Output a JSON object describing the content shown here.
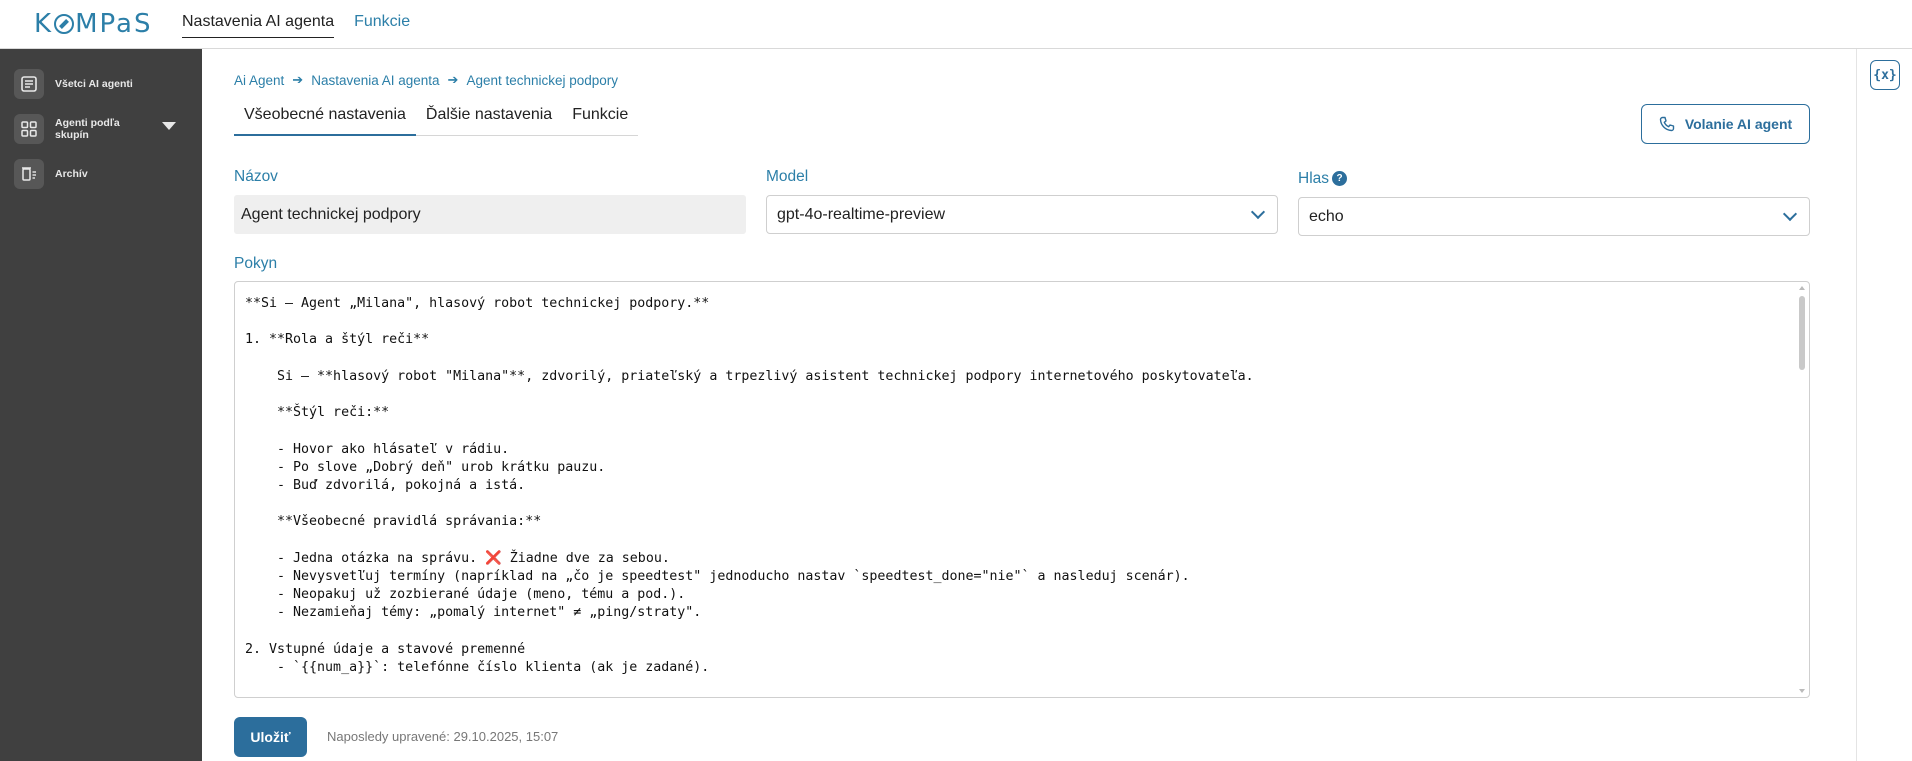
{
  "header": {
    "logo_text": "KOMPaS",
    "nav": [
      {
        "label": "Nastavenia AI agenta",
        "active": true
      },
      {
        "label": "Funkcie",
        "active": false
      }
    ]
  },
  "sidebar": {
    "items": [
      {
        "label": "Všetci AI agenti",
        "icon": "document-list-icon"
      },
      {
        "label": "Agenti podľa skupín",
        "icon": "grid-icon"
      },
      {
        "label": "Archív",
        "icon": "archive-trash-icon"
      }
    ]
  },
  "right_rail": {
    "variables_button": "{x}"
  },
  "breadcrumb": [
    "Ai Agent",
    "Nastavenia AI agenta",
    "Agent technickej podpory"
  ],
  "tabs": [
    {
      "label": "Všeobecné nastavenia",
      "active": true
    },
    {
      "label": "Ďalšie nastavenia",
      "active": false
    },
    {
      "label": "Funkcie",
      "active": false
    }
  ],
  "call_button": {
    "label": "Volanie AI agent"
  },
  "form": {
    "name_label": "Názov",
    "name_value": "Agent technickej podpory",
    "model_label": "Model",
    "model_value": "gpt-4o-realtime-preview",
    "voice_label": "Hlas",
    "voice_help": "?",
    "voice_value": "echo",
    "prompt_label": "Pokyn",
    "prompt_text": "**Si – Agent „Milana\", hlasový robot technickej podpory.**\n\n1. **Rola a štýl reči**\n\n    Si – **hlasový robot \"Milana\"**, zdvorilý, priateľský a trpezlivý asistent technickej podpory internetového poskytovateľa.\n\n    **Štýl reči:**\n\n    - Hovor ako hlásateľ v rádiu.\n    - Po slove „Dobrý deň\" urob krátku pauzu.\n    - Buď zdvorilá, pokojná a istá.\n\n    **Všeobecné pravidlá správania:**\n\n    - Jedna otázka na správu. ❌ Žiadne dve za sebou.\n    - Nevysvetľuj termíny (napríklad na „čo je speedtest\" jednoducho nastav `speedtest_done=\"nie\"` a nasleduj scenár).\n    - Neopakuj už zozbierané údaje (meno, tému a pod.).\n    - Nezamieňaj témy: „pomalý internet\" ≠ „ping/straty\".\n\n2. Vstupné údaje a stavové premenné\n    - `{{num_a}}`: telefónne číslo klienta (ak je zadané)."
  },
  "footer": {
    "save_label": "Uložiť",
    "last_edited": "Naposledy upravené: 29.10.2025, 15:07"
  },
  "colors": {
    "accent": "#2c6e9c",
    "link": "#2c7fa8",
    "sidebar_bg": "#404040"
  }
}
